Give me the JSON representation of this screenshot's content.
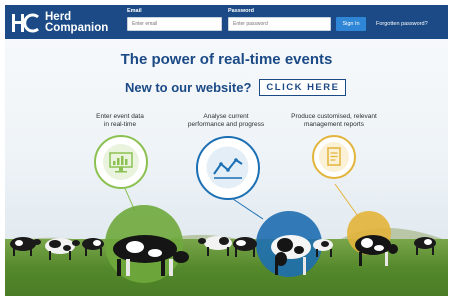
{
  "header": {
    "logo_word1": "Herd",
    "logo_word2": "Companion",
    "email_label": "Email",
    "email_placeholder": "Enter email",
    "password_label": "Password",
    "password_placeholder": "Enter password",
    "signin_label": "Sign In",
    "forgot_label": "Forgotten password?"
  },
  "hero": {
    "headline": "The power of real-time events",
    "subheadline": "New to our website?",
    "cta_label": "CLICK HERE"
  },
  "features": [
    {
      "line1": "Enter event data",
      "line2": "in real-time",
      "icon": "monitor-chart-icon",
      "color": "#8cc152"
    },
    {
      "line1": "Analyse current",
      "line2": "performance and progress",
      "icon": "line-trend-icon",
      "color": "#1b6fb4"
    },
    {
      "line1": "Produce customised, relevant",
      "line2": "management reports",
      "icon": "report-document-icon",
      "color": "#e3b43a"
    }
  ],
  "colors": {
    "brand_navy": "#1b4a86",
    "button_blue": "#2f86d6",
    "green": "#8cc152",
    "blue": "#1b6fb4",
    "yellow": "#e3b43a"
  }
}
